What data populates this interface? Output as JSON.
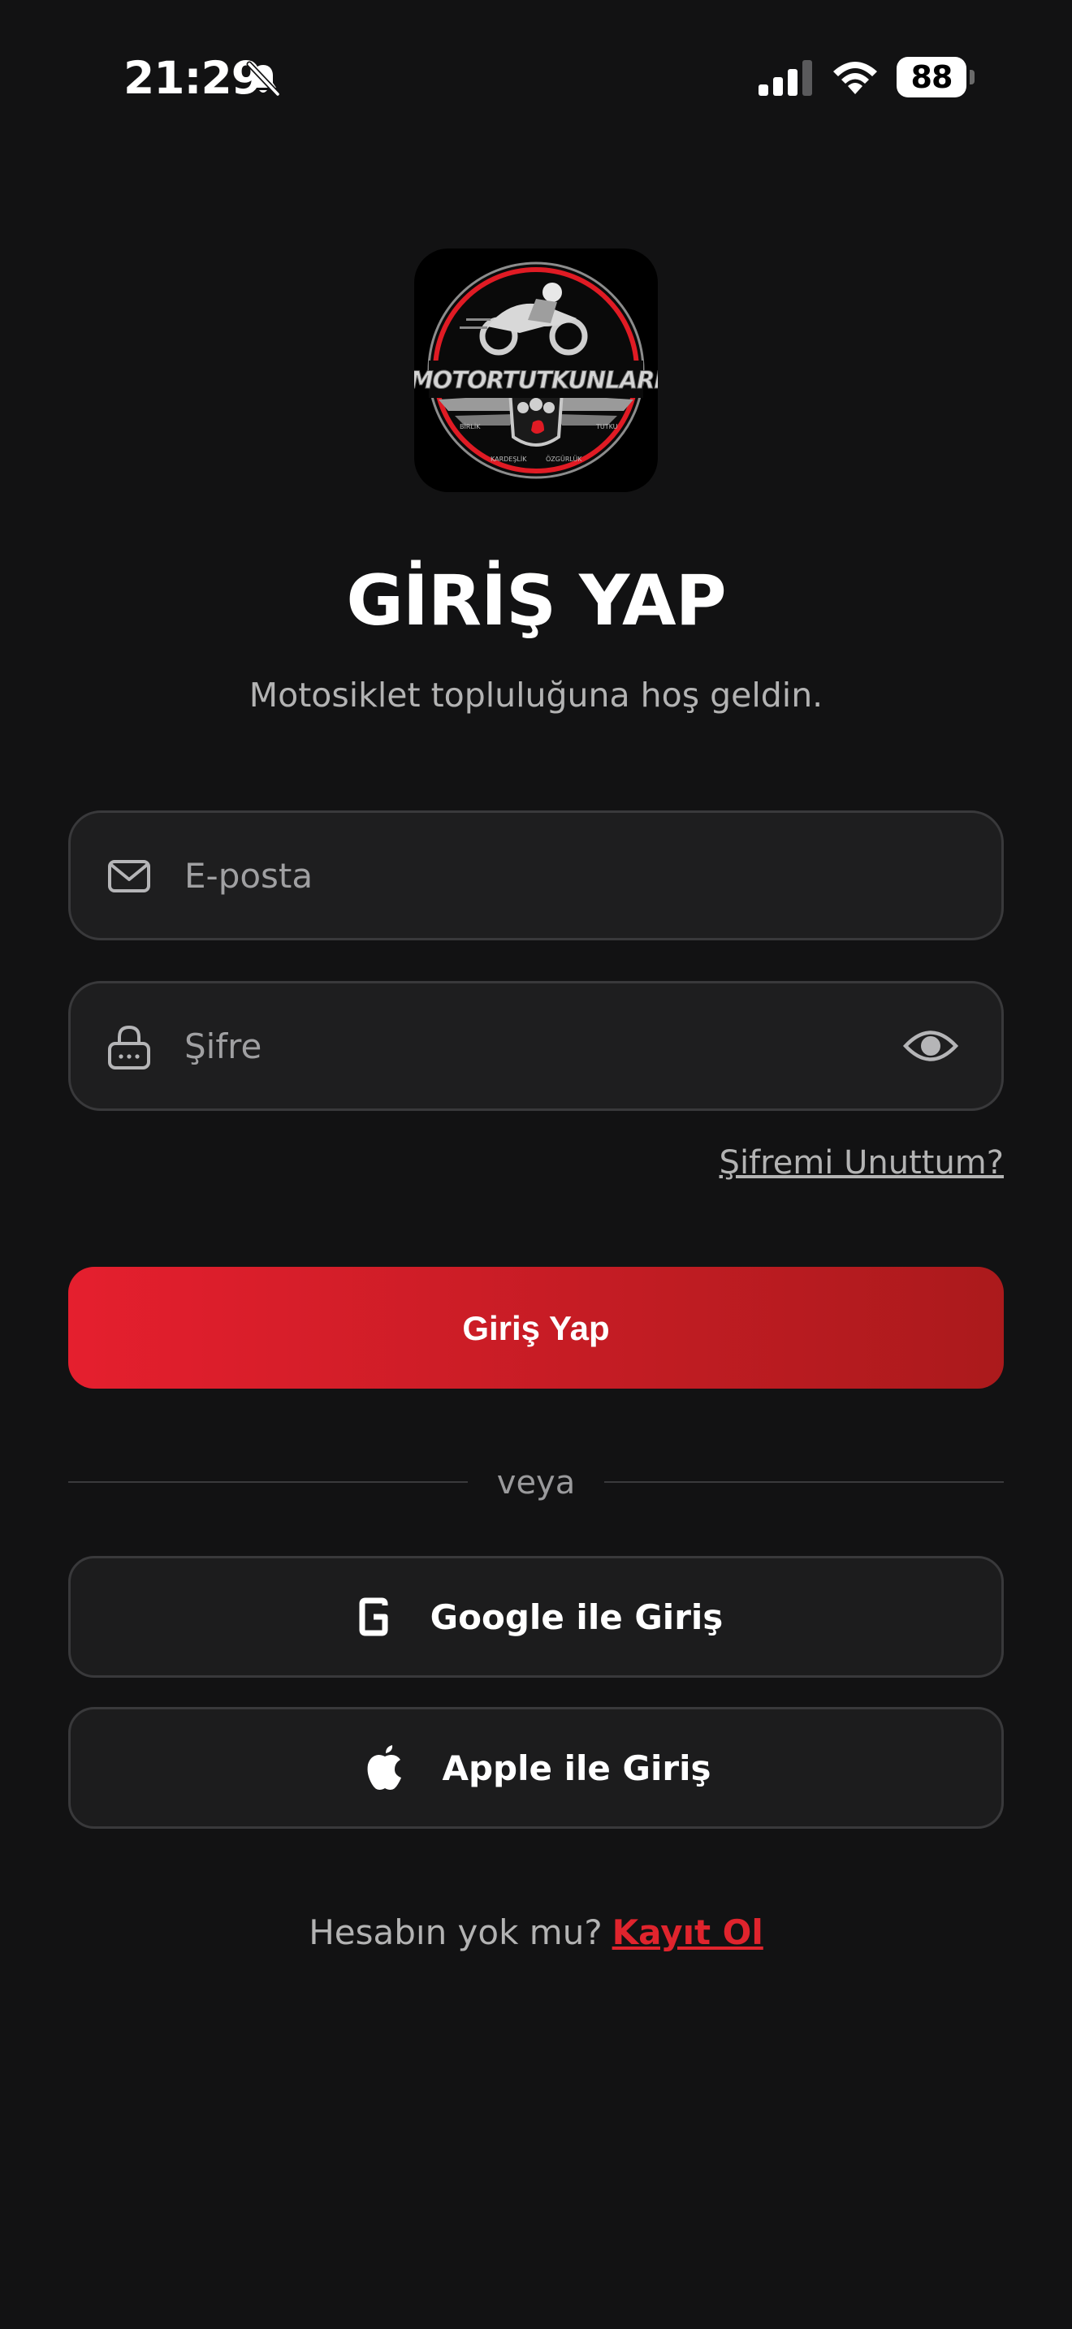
{
  "status_bar": {
    "time": "21:29",
    "battery": "88"
  },
  "logo": {
    "brand_text": "MOTORTUTKUNLARI",
    "tagline_words": [
      "BİRLİK",
      "KARDEŞLİK",
      "ÖZGÜRLÜK",
      "TUTKU"
    ]
  },
  "header": {
    "title": "GİRİŞ YAP",
    "subtitle": "Motosiklet topluluğuna hoş geldin."
  },
  "form": {
    "email_placeholder": "E-posta",
    "password_placeholder": "Şifre",
    "forgot_label": "Şifremi Unuttum?",
    "submit_label": "Giriş Yap"
  },
  "divider": {
    "label": "veya"
  },
  "social": {
    "google_label": "Google ile Giriş",
    "apple_label": "Apple ile Giriş"
  },
  "signup": {
    "prompt": "Hesabın yok mu?",
    "link_label": "Kayıt Ol"
  },
  "colors": {
    "background": "#121213",
    "accent": "#e51f2e",
    "accent_dark": "#ab1a1c",
    "field_bg": "#1e1e1f",
    "field_border": "#39393b"
  },
  "icons": {
    "email": "envelope-icon",
    "password": "lock-icon",
    "reveal": "eye-icon",
    "google": "google-g-icon",
    "apple": "apple-icon"
  }
}
